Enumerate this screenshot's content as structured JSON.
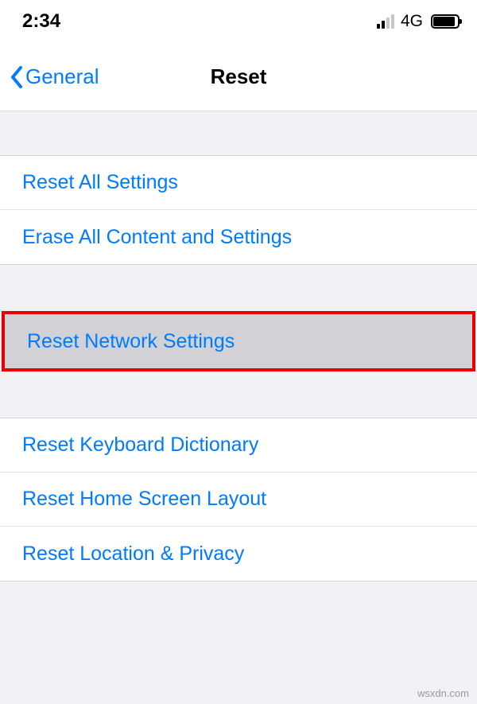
{
  "status": {
    "time": "2:34",
    "network_label": "4G"
  },
  "nav": {
    "back_label": "General",
    "title": "Reset"
  },
  "section1": {
    "reset_all": "Reset All Settings",
    "erase_all": "Erase All Content and Settings"
  },
  "section2": {
    "reset_network": "Reset Network Settings"
  },
  "section3": {
    "reset_keyboard": "Reset Keyboard Dictionary",
    "reset_home": "Reset Home Screen Layout",
    "reset_location": "Reset Location & Privacy"
  },
  "watermark": "wsxdn.com"
}
